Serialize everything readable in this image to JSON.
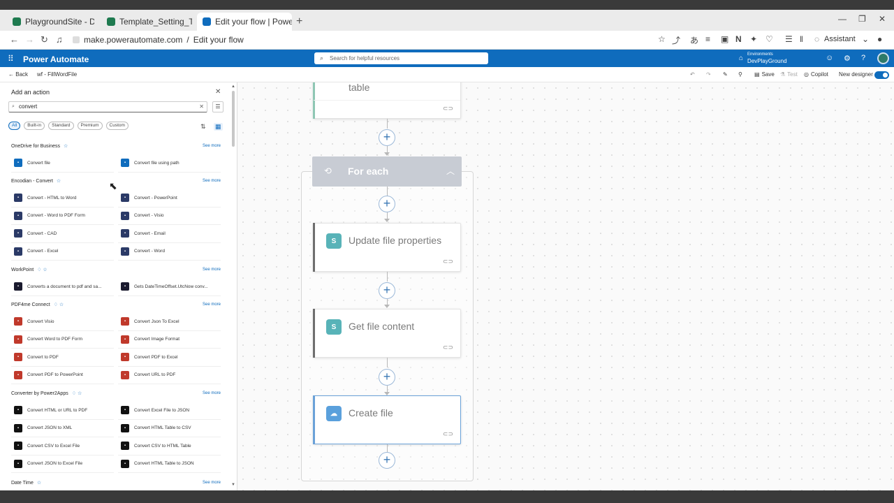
{
  "browser": {
    "tabs": [
      {
        "label": "PlaygroundSite - Demo - All I",
        "color": "#1e7a4f"
      },
      {
        "label": "Template_Setting_Table",
        "color": "#1e7a4f"
      },
      {
        "label": "Edit your flow | Power Autom:",
        "color": "#0f6cbd"
      }
    ],
    "url_domain": "make.powerautomate.com",
    "url_sep": "/",
    "url_path": "Edit your flow",
    "assistant_label": "Assistant"
  },
  "header": {
    "brand": "Power Automate",
    "search_placeholder": "Search for helpful resources",
    "env_label": "Environments",
    "env_name": "DevPlayGround"
  },
  "cmdbar": {
    "back_label": "Back",
    "flow_name": "wf - FillWordFile",
    "save_label": "Save",
    "test_label": "Test",
    "copilot_label": "Copilot",
    "new_designer_label": "New designer"
  },
  "panel": {
    "title": "Add an action",
    "search_value": "convert",
    "filters": [
      "All",
      "Built-in",
      "Standard",
      "Premium",
      "Custom"
    ],
    "see_more": "See more",
    "groups": [
      {
        "name": "OneDrive for Business",
        "premium": false,
        "color": "#0f6cbd",
        "actions": [
          "Convert file",
          "Convert file using path"
        ]
      },
      {
        "name": "Encodian - Convert",
        "premium": false,
        "color": "#2b3a67",
        "actions": [
          "Convert - HTML to Word",
          "Convert - PowerPoint",
          "Convert - Word to PDF Form",
          "Convert - Visio",
          "Convert - CAD",
          "Convert - Email",
          "Convert - Excel",
          "Convert - Word"
        ]
      },
      {
        "name": "WorkPoint",
        "premium": true,
        "color": "#1a1a2e",
        "actions": [
          "Converts a document to pdf and sa...",
          "Gets DateTimeOffset.UtcNow conv..."
        ]
      },
      {
        "name": "PDF4me Connect",
        "premium": true,
        "color": "#c0392b",
        "actions": [
          "Convert Visio",
          "Convert Json To Excel",
          "Convert Word to PDF Form",
          "Convert Image Format",
          "Convert to PDF",
          "Convert PDF to Excel",
          "Convert PDF to PowerPoint",
          "Convert URL to PDF"
        ]
      },
      {
        "name": "Converter by Power2Apps",
        "premium": true,
        "color": "#111111",
        "actions": [
          "Convert HTML or URL to PDF",
          "Convert Excel File to JSON",
          "Convert JSON to XML",
          "Convert HTML Table to CSV",
          "Convert CSV to Excel File",
          "Convert CSV to HTML Table",
          "Convert JSON to Excel File",
          "Convert HTML Table to JSON"
        ]
      },
      {
        "name": "Date Time",
        "premium": false,
        "color": "#555555",
        "actions": []
      }
    ]
  },
  "canvas": {
    "top_card_title": "table",
    "foreach_title": "For each",
    "cards": [
      {
        "title": "Update file properties",
        "icon": "sharepoint-icon",
        "color": "#0b828a"
      },
      {
        "title": "Get file content",
        "icon": "sharepoint-icon",
        "color": "#0b828a"
      },
      {
        "title": "Create file",
        "icon": "onedrive-icon",
        "color": "#0f6cbd"
      }
    ],
    "plus": "+"
  }
}
